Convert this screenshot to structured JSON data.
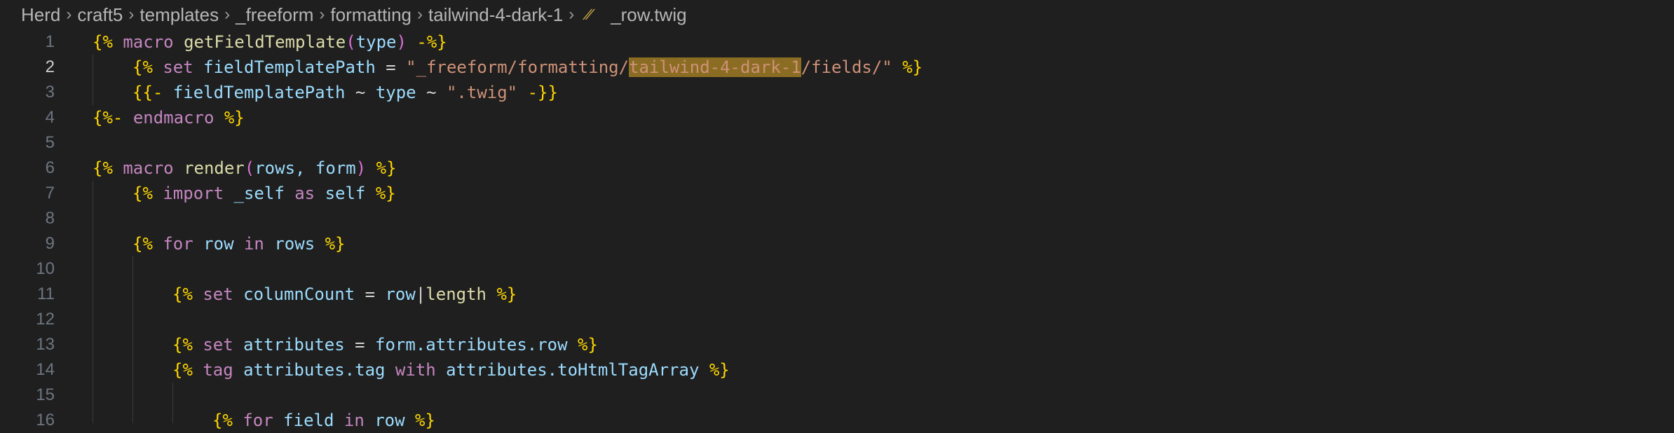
{
  "breadcrumb": {
    "items": [
      "Herd",
      "craft5",
      "templates",
      "_freeform",
      "formatting",
      "tailwind-4-dark-1"
    ],
    "file": "_row.twig",
    "file_icon": "twig-file-icon"
  },
  "editor": {
    "active_line": 2,
    "selected_text": "tailwind-4-dark-1",
    "lines": [
      {
        "number": "1"
      },
      {
        "number": "2"
      },
      {
        "number": "3"
      },
      {
        "number": "4"
      },
      {
        "number": "5"
      },
      {
        "number": "6"
      },
      {
        "number": "7"
      },
      {
        "number": "8"
      },
      {
        "number": "9"
      },
      {
        "number": "10"
      },
      {
        "number": "11"
      },
      {
        "number": "12"
      },
      {
        "number": "13"
      },
      {
        "number": "14"
      },
      {
        "number": "15"
      },
      {
        "number": "16"
      }
    ],
    "tokens": {
      "l1": [
        "{%",
        "macro",
        "getFieldTemplate",
        "(",
        "type",
        ")",
        "-%}"
      ],
      "l2": [
        "{%",
        "set",
        "fieldTemplatePath",
        "=",
        "\"_freeform/formatting/",
        "tailwind-4-dark-1",
        "/fields/\"",
        "%}"
      ],
      "l3": [
        "{{-",
        "fieldTemplatePath",
        "~",
        "type",
        "~",
        "\".twig\"",
        "-}}"
      ],
      "l4": [
        "{%-",
        "endmacro",
        "%}"
      ],
      "l6": [
        "{%",
        "macro",
        "render",
        "(",
        "rows,",
        "form",
        ")",
        "%}"
      ],
      "l7": [
        "{%",
        "import",
        "_self",
        "as",
        "self",
        "%}"
      ],
      "l9": [
        "{%",
        "for",
        "row",
        "in",
        "rows",
        "%}"
      ],
      "l11": [
        "{%",
        "set",
        "columnCount",
        "=",
        "row",
        "|",
        "length",
        "%}"
      ],
      "l13": [
        "{%",
        "set",
        "attributes",
        "=",
        "form.attributes.row",
        "%}"
      ],
      "l14": [
        "{%",
        "tag",
        "attributes.tag",
        "with",
        "attributes.toHtmlTagArray",
        "%}"
      ],
      "l16": [
        "{%",
        "for",
        "field",
        "in",
        "row",
        "%}"
      ]
    }
  }
}
